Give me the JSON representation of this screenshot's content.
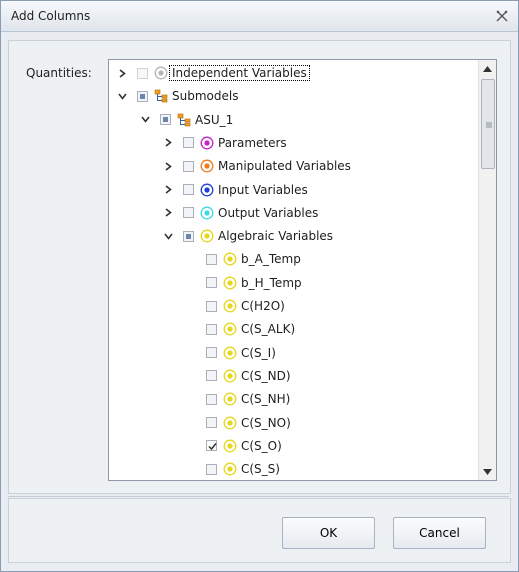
{
  "window": {
    "title": "Add Columns",
    "close_icon": "close-icon"
  },
  "form": {
    "quantities_label": "Quantities:"
  },
  "tree": {
    "items": [
      {
        "label": "Independent Variables",
        "icon": "radio-gray-icon",
        "expander": "collapsed",
        "check": "empty-disabled",
        "selected": true
      },
      {
        "label": "Submodels",
        "icon": "hierarchy-icon",
        "expander": "expanded",
        "check": "partial"
      },
      {
        "label": "ASU_1",
        "icon": "hierarchy-icon",
        "expander": "expanded",
        "check": "partial"
      },
      {
        "label": "Parameters",
        "icon": "radio-magenta-icon",
        "expander": "collapsed",
        "check": "empty"
      },
      {
        "label": "Manipulated Variables",
        "icon": "radio-orange-icon",
        "expander": "collapsed",
        "check": "empty"
      },
      {
        "label": "Input Variables",
        "icon": "radio-blue-icon",
        "expander": "collapsed",
        "check": "empty"
      },
      {
        "label": "Output Variables",
        "icon": "radio-cyan-icon",
        "expander": "collapsed",
        "check": "empty"
      },
      {
        "label": "Algebraic Variables",
        "icon": "radio-yellow-icon",
        "expander": "expanded",
        "check": "partial"
      },
      {
        "label": "b_A_Temp",
        "icon": "radio-yellow-icon",
        "expander": "none",
        "check": "empty"
      },
      {
        "label": "b_H_Temp",
        "icon": "radio-yellow-icon",
        "expander": "none",
        "check": "empty"
      },
      {
        "label": "C(H2O)",
        "icon": "radio-yellow-icon",
        "expander": "none",
        "check": "empty"
      },
      {
        "label": "C(S_ALK)",
        "icon": "radio-yellow-icon",
        "expander": "none",
        "check": "empty"
      },
      {
        "label": "C(S_I)",
        "icon": "radio-yellow-icon",
        "expander": "none",
        "check": "empty"
      },
      {
        "label": "C(S_ND)",
        "icon": "radio-yellow-icon",
        "expander": "none",
        "check": "empty"
      },
      {
        "label": "C(S_NH)",
        "icon": "radio-yellow-icon",
        "expander": "none",
        "check": "empty"
      },
      {
        "label": "C(S_NO)",
        "icon": "radio-yellow-icon",
        "expander": "none",
        "check": "empty"
      },
      {
        "label": "C(S_O)",
        "icon": "radio-yellow-icon",
        "expander": "none",
        "check": "checked"
      },
      {
        "label": "C(S_S)",
        "icon": "radio-yellow-icon",
        "expander": "none",
        "check": "empty"
      }
    ]
  },
  "colors": {
    "magenta": "#c81fc8",
    "orange": "#f07a1a",
    "blue": "#1b3fd6",
    "cyan": "#3fd8e8",
    "yellow": "#e8d61a",
    "gray": "#b4b4b4",
    "hierarchy": "#f0a020"
  },
  "buttons": {
    "ok": "OK",
    "cancel": "Cancel"
  }
}
